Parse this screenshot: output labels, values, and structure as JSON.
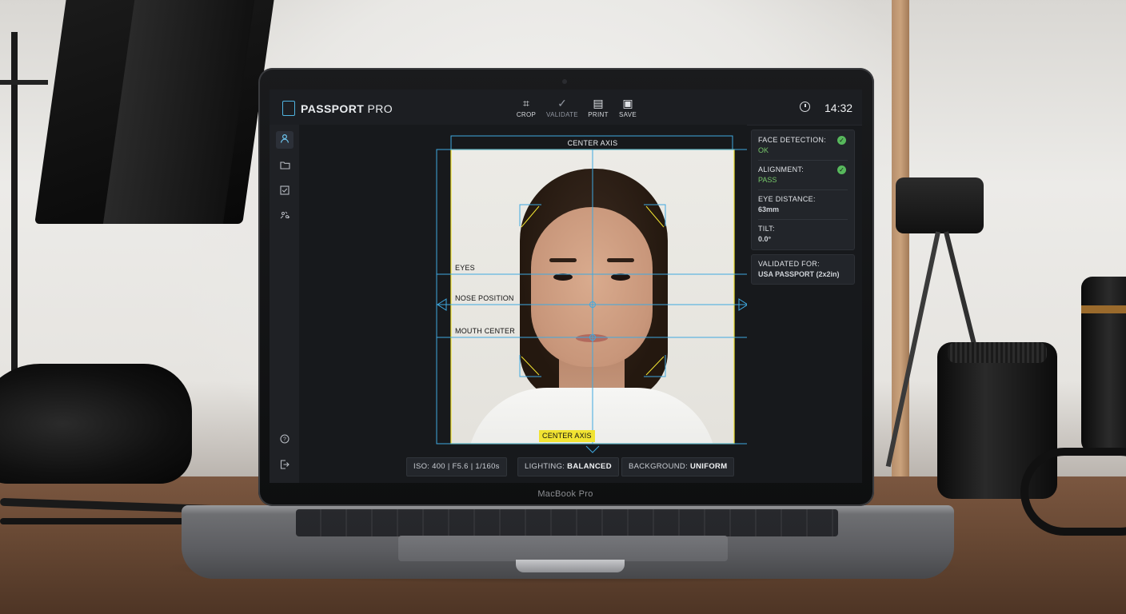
{
  "app": {
    "name_bold": "PASSPORT",
    "name_light": " PRO",
    "time": "14:32",
    "brand_label": "MacBook Pro"
  },
  "toolbar": {
    "crop_label": "CROP",
    "validate_label": "VALIDATE",
    "print_label": "PRINT",
    "save_label": "SAVE"
  },
  "sidebar": {
    "items": [
      "profile",
      "folder",
      "checklist",
      "settings"
    ],
    "bottom": [
      "help",
      "logout"
    ]
  },
  "guides": {
    "center_axis_top": "CENTER AXIS",
    "center_axis_bottom": "CENTER AXIS",
    "eyes": "EYES",
    "nose": "NOSE POSITION",
    "mouth": "MOUTH CENTER"
  },
  "status_bar": {
    "camera": "ISO: 400 | F5.6 | 1/160s",
    "lighting_key": "LIGHTING: ",
    "lighting_val": "BALANCED",
    "background_key": "BACKGROUND: ",
    "background_val": "UNIFORM"
  },
  "checks": {
    "face_detection_key": "FACE DETECTION:",
    "face_detection_val": "OK",
    "alignment_key": "ALIGNMENT:",
    "alignment_val": "PASS",
    "eye_distance_key": "EYE DISTANCE:",
    "eye_distance_val": "63mm",
    "tilt_key": "TILT:",
    "tilt_val": "0.0°"
  },
  "validation": {
    "key": "VALIDATED FOR:",
    "val": "USA PASSPORT (2x2in)"
  },
  "colors": {
    "accent": "#4fb3e0",
    "guide_line": "#3fa9e0",
    "highlight_yellow": "#f1e332",
    "ok_green": "#57b85c"
  }
}
